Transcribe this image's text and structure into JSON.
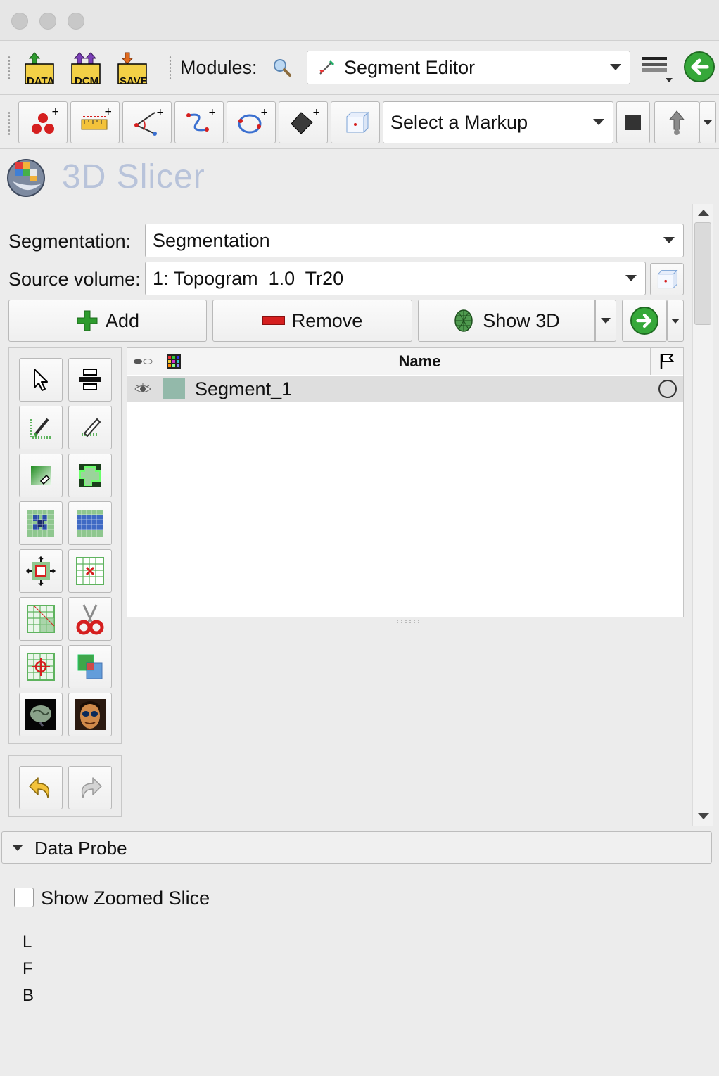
{
  "toolbar": {
    "data_icon_label": "DATA",
    "dcm_icon_label": "DCM",
    "save_icon_label": "SAVE",
    "modules_label": "Modules:",
    "module_selected": "Segment Editor",
    "markup_selector": "Select a Markup"
  },
  "brand": {
    "app_name": "3D Slicer"
  },
  "segment_editor": {
    "segmentation_label": "Segmentation:",
    "segmentation_value": "Segmentation",
    "source_volume_label": "Source volume:",
    "source_volume_value": "1: Topogram  1.0  Tr20",
    "add_label": "Add",
    "remove_label": "Remove",
    "show3d_label": "Show 3D",
    "table": {
      "name_header": "Name",
      "rows": [
        {
          "name": "Segment_1",
          "color": "#93b9aa"
        }
      ]
    }
  },
  "data_probe": {
    "section_title": "Data Probe",
    "show_zoomed_slice_label": "Show Zoomed Slice",
    "show_zoomed_slice_checked": false,
    "coords": [
      "L",
      "F",
      "B"
    ]
  },
  "colors": {
    "add_green": "#2e9b2e",
    "remove_red": "#d51f1f",
    "arrow_green": "#36a83a",
    "brand_text": "#b8c3da"
  }
}
